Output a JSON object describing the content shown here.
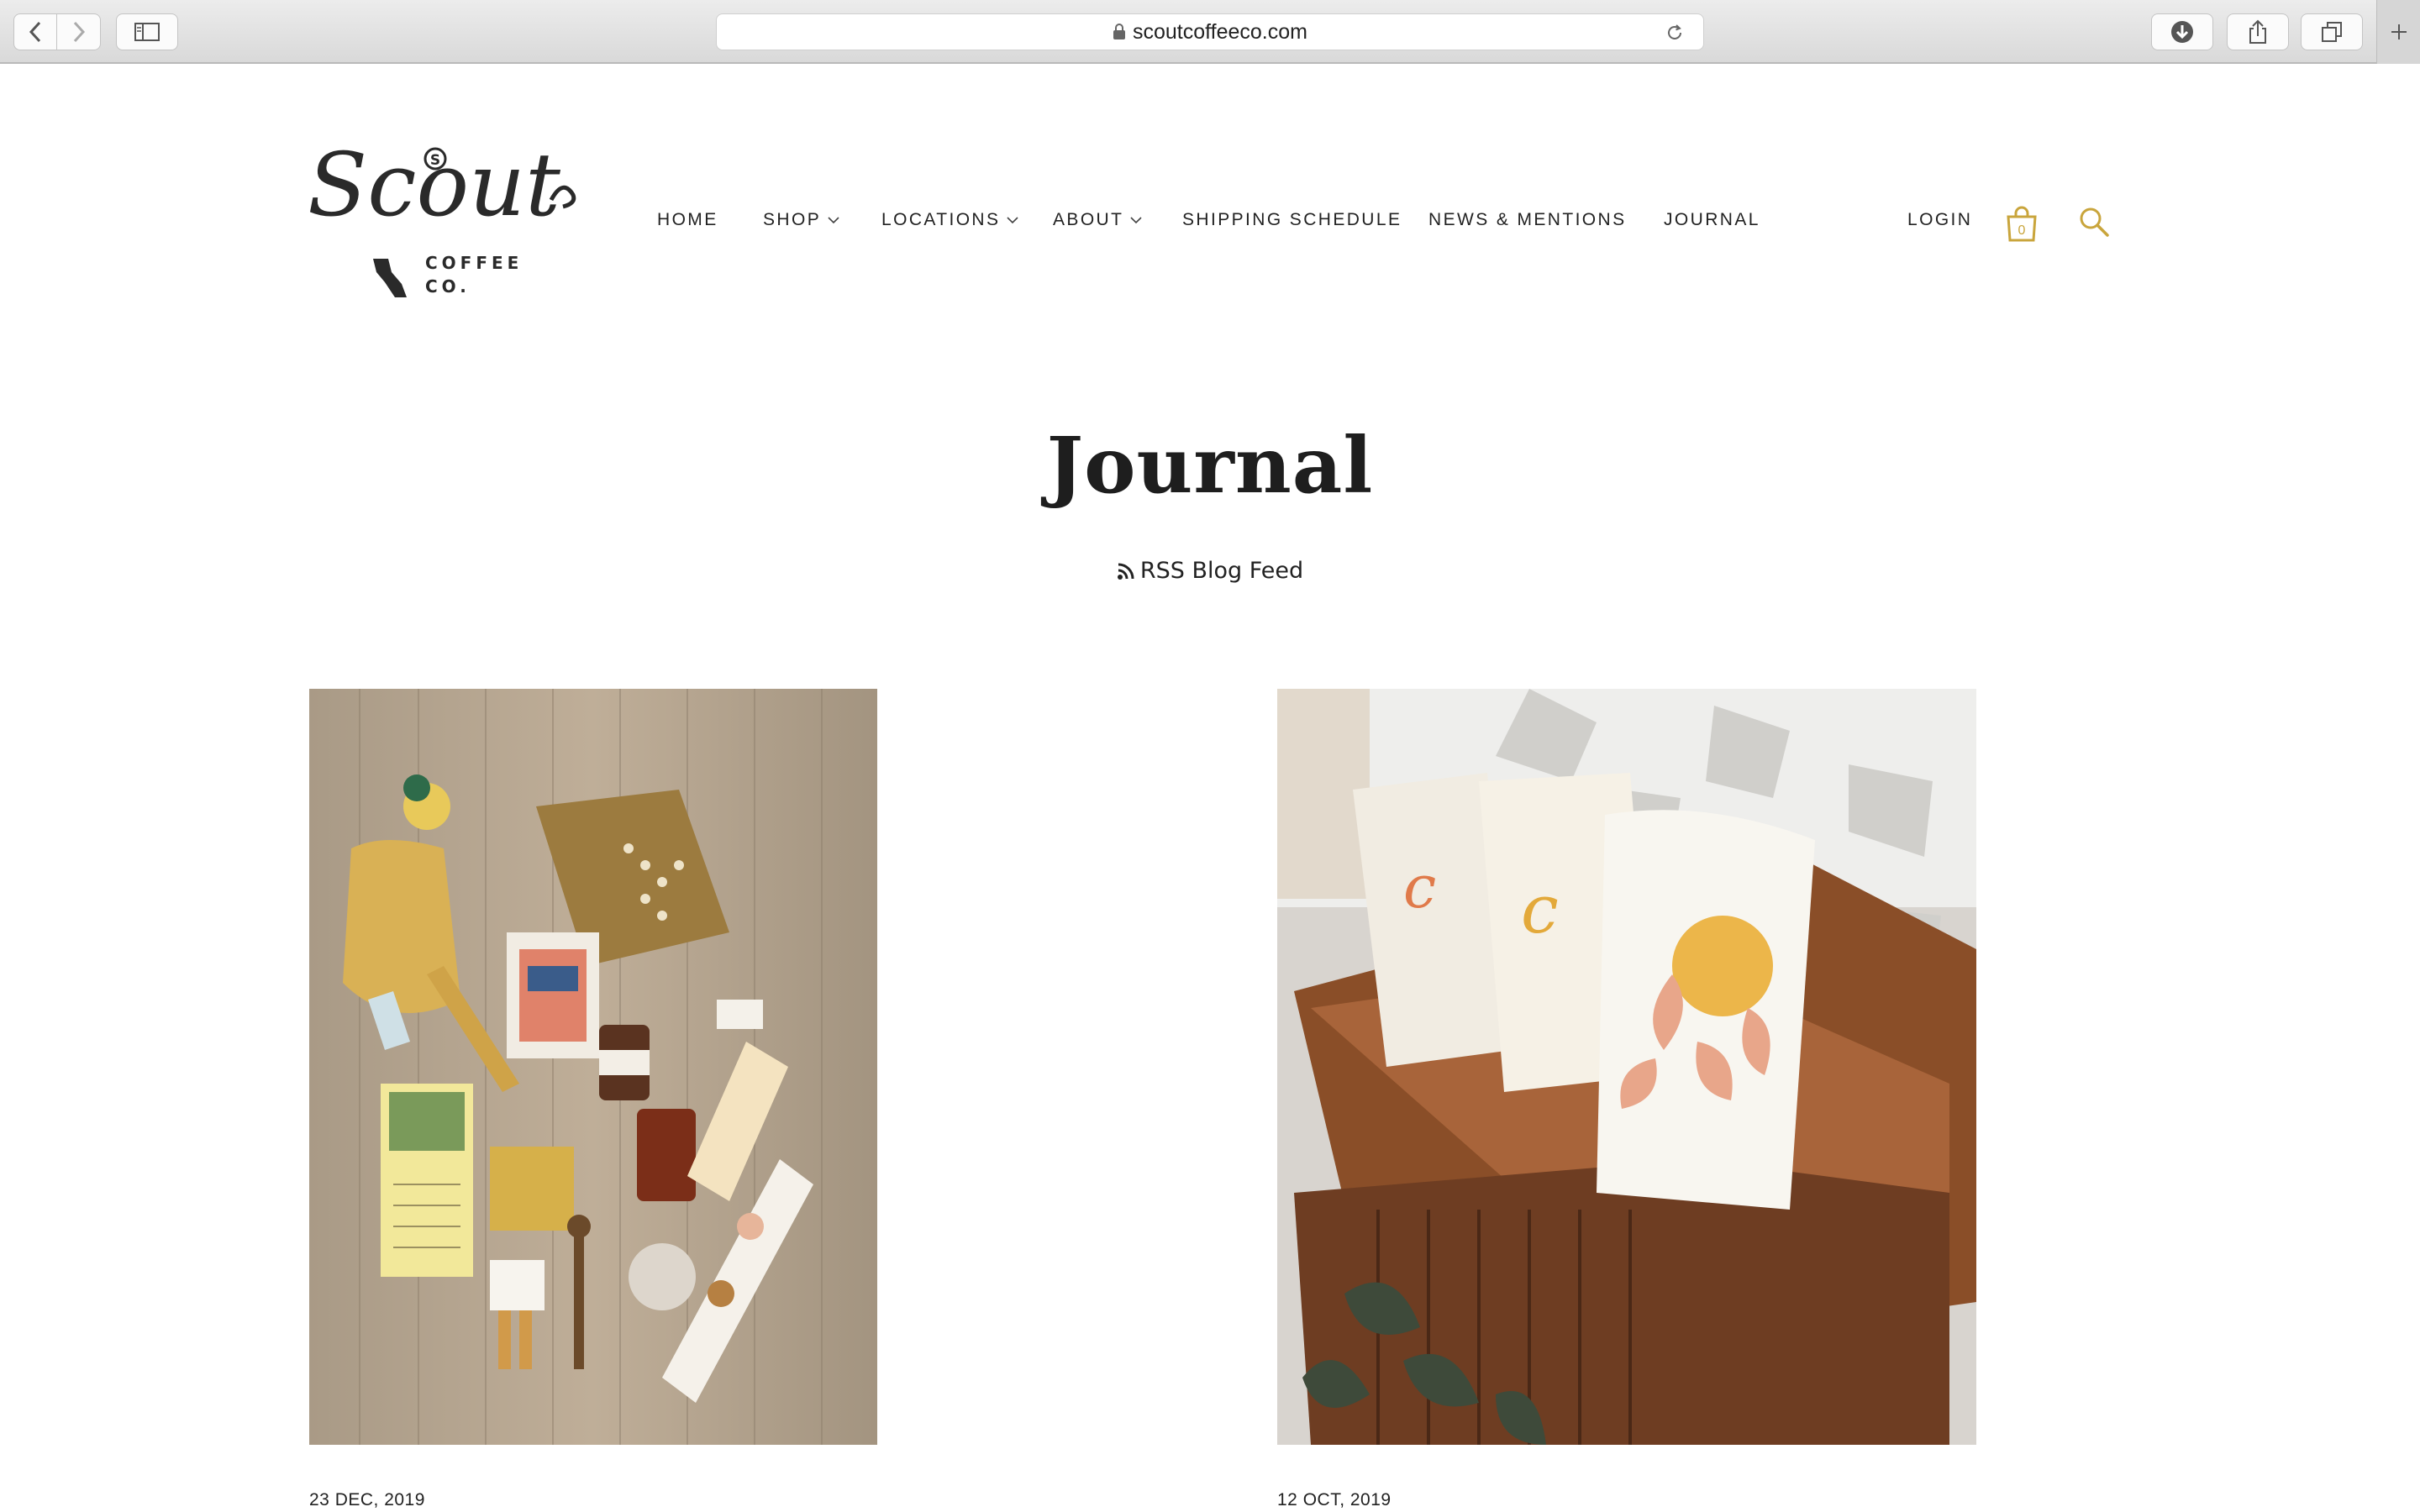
{
  "browser": {
    "url": "scoutcoffeeco.com",
    "icons": [
      "back-icon",
      "forward-icon",
      "sidebar-icon",
      "lock-icon",
      "reload-icon",
      "download-icon",
      "share-icon",
      "tabs-icon",
      "new-tab-icon"
    ]
  },
  "brand": {
    "logo_script": "Scout",
    "logo_sub_1": "COFFEE",
    "logo_sub_2": "CO.",
    "logo_badge": "S"
  },
  "nav": {
    "items": [
      {
        "label": "HOME",
        "has_dropdown": false
      },
      {
        "label": "SHOP",
        "has_dropdown": true
      },
      {
        "label": "LOCATIONS",
        "has_dropdown": true
      },
      {
        "label": "ABOUT",
        "has_dropdown": true
      },
      {
        "label": "SHIPPING SCHEDULE",
        "has_dropdown": false
      },
      {
        "label": "NEWS & MENTIONS",
        "has_dropdown": false
      },
      {
        "label": "JOURNAL",
        "has_dropdown": false
      }
    ],
    "login": "LOGIN",
    "cart_count": "0"
  },
  "page": {
    "title": "Journal",
    "rss_label": "RSS Blog Feed"
  },
  "posts": [
    {
      "date": "23 DEC, 2019",
      "image": "gift-flatlay-photo"
    },
    {
      "date": "12 OCT, 2019",
      "image": "tote-bags-on-bench-photo"
    }
  ],
  "colors": {
    "accent": "#c9a53c",
    "text": "#222222",
    "chrome": "#dcdcdc"
  }
}
